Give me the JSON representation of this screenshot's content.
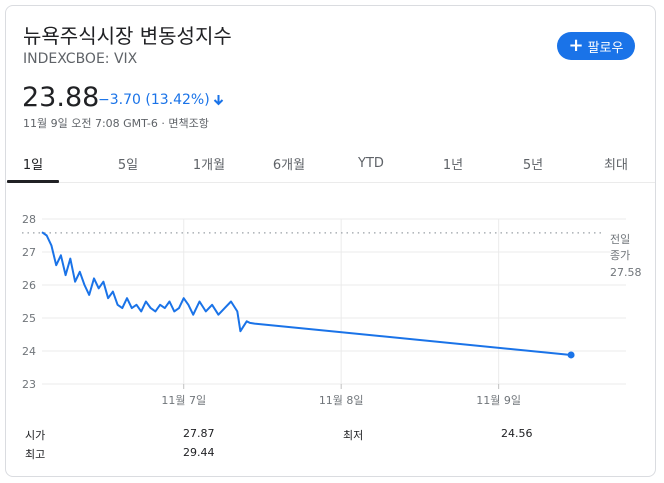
{
  "header": {
    "title": "뉴욕주식시장 변동성지수",
    "ticker": "INDEXCBOE: VIX",
    "follow_label": "팔로우"
  },
  "quote": {
    "price": "23.88",
    "change": "−3.70 (13.42%)",
    "meta": "11월 9일 오전 7:08 GMT-6 · 면책조항",
    "change_color": "#1a73e8"
  },
  "tabs": [
    {
      "label": "1일",
      "active": true
    },
    {
      "label": "5일"
    },
    {
      "label": "1개월"
    },
    {
      "label": "6개월"
    },
    {
      "label": "YTD"
    },
    {
      "label": "1년"
    },
    {
      "label": "5년"
    },
    {
      "label": "최대"
    }
  ],
  "chart_data": {
    "type": "line",
    "ylim": [
      23,
      28
    ],
    "yticks": [
      "28",
      "27",
      "26",
      "25",
      "24",
      "23"
    ],
    "xticks": [
      "11월 7일",
      "11월 8일",
      "11월 9일"
    ],
    "series_color": "#1a73e8",
    "prev_close": {
      "label_line1": "전일",
      "label_line2": "종가",
      "value": "27.58",
      "y": 27.58
    },
    "x": [
      0.0,
      0.03,
      0.06,
      0.09,
      0.12,
      0.15,
      0.18,
      0.21,
      0.24,
      0.27,
      0.3,
      0.33,
      0.36,
      0.39,
      0.42,
      0.45,
      0.48,
      0.51,
      0.54,
      0.57,
      0.6,
      0.63,
      0.66,
      0.69,
      0.72,
      0.75,
      0.78,
      0.81,
      0.84,
      0.87,
      0.9,
      0.93,
      0.96,
      1.0,
      1.04,
      1.08,
      1.12,
      1.16,
      1.2,
      1.24,
      1.26,
      1.3,
      1.32,
      1.35,
      3.36
    ],
    "y": [
      27.6,
      27.5,
      27.2,
      26.6,
      26.9,
      26.3,
      26.8,
      26.1,
      26.4,
      26.0,
      25.7,
      26.2,
      25.9,
      26.1,
      25.6,
      25.8,
      25.4,
      25.3,
      25.6,
      25.3,
      25.4,
      25.2,
      25.5,
      25.3,
      25.2,
      25.4,
      25.3,
      25.5,
      25.2,
      25.3,
      25.6,
      25.4,
      25.1,
      25.5,
      25.2,
      25.4,
      25.1,
      25.3,
      25.5,
      25.2,
      24.6,
      24.9,
      24.85,
      24.83,
      23.88
    ],
    "xlim": [
      0,
      3.55
    ],
    "xtick_values": [
      0.9,
      1.9,
      2.9
    ],
    "grid": true
  },
  "stats": [
    {
      "label": "시가",
      "value": "27.87"
    },
    {
      "label": "최저",
      "value": "24.56"
    },
    {
      "label": "최고",
      "value": "29.44"
    }
  ]
}
